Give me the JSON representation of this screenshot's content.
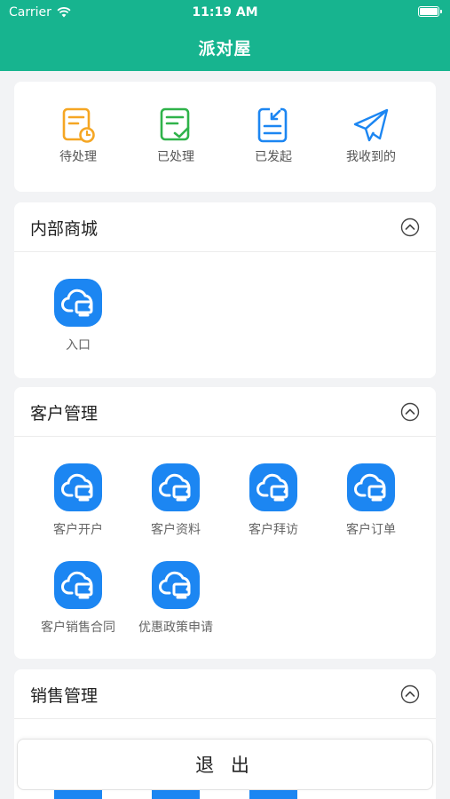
{
  "status_bar": {
    "carrier": "Carrier",
    "time": "11:19 AM"
  },
  "nav": {
    "title": "派对屋"
  },
  "quick_actions": [
    {
      "label": "待处理",
      "icon": "pending-doc-icon",
      "color": "#f5a623"
    },
    {
      "label": "已处理",
      "icon": "processed-doc-icon",
      "color": "#2fb34a"
    },
    {
      "label": "已发起",
      "icon": "initiated-doc-icon",
      "color": "#1c86f2"
    },
    {
      "label": "我收到的",
      "icon": "paper-plane-icon",
      "color": "#1c86f2"
    }
  ],
  "sections": [
    {
      "title": "内部商城",
      "items": [
        "入口"
      ]
    },
    {
      "title": "客户管理",
      "items": [
        "客户开户",
        "客户资料",
        "客户拜访",
        "客户订单",
        "客户销售合同",
        "优惠政策申请"
      ]
    },
    {
      "title": "销售管理",
      "items": []
    }
  ],
  "footer": {
    "logout_label": "退 出"
  },
  "colors": {
    "brand": "#17b48f",
    "app_icon": "#1c86f2"
  }
}
